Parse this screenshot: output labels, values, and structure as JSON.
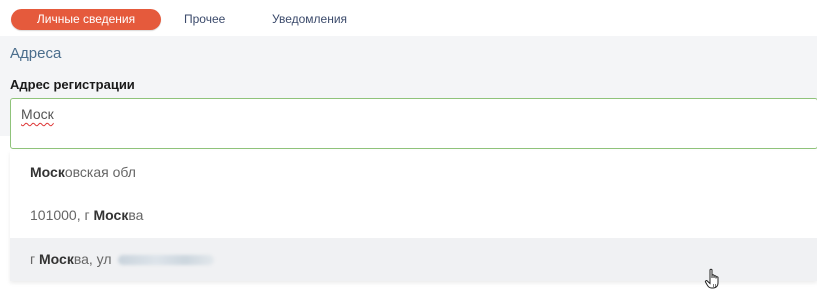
{
  "tabs": [
    {
      "label": "Личные сведения",
      "active": true
    },
    {
      "label": "Прочее",
      "active": false
    },
    {
      "label": "Уведомления",
      "active": false
    }
  ],
  "section": {
    "title": "Адреса"
  },
  "registration_address": {
    "label": "Адрес регистрации",
    "value": "Моск"
  },
  "suggestions": [
    {
      "match": "Моск",
      "rest": "овская обл",
      "prefix": ""
    },
    {
      "prefix": "101000, г ",
      "match": "Моск",
      "rest": "ва"
    },
    {
      "prefix": "г ",
      "match": "Моск",
      "rest": "ва, ул",
      "redacted": true
    }
  ],
  "colors": {
    "active_tab": "#e55a3c",
    "input_border": "#8fc37a",
    "section_title": "#4a6d8c",
    "highlight_row": "#f0f1f3"
  },
  "icons": {
    "cursor": "hand-pointer-icon"
  }
}
